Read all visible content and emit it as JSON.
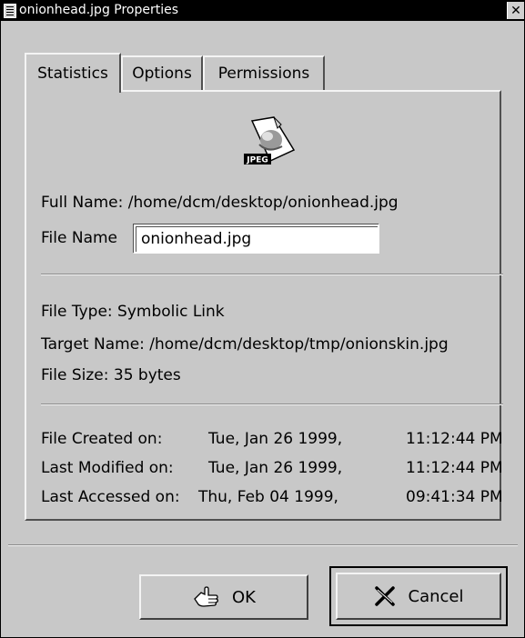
{
  "window": {
    "title": "onionhead.jpg Properties",
    "close_glyph": "✕"
  },
  "tabs": [
    {
      "label": "Statistics",
      "active": true
    },
    {
      "label": "Options",
      "active": false
    },
    {
      "label": "Permissions",
      "active": false
    }
  ],
  "file_icon": {
    "icon": "jpeg-file-icon",
    "badge_text": "JPEG"
  },
  "statistics": {
    "full_name": "Full Name: /home/dcm/desktop/onionhead.jpg",
    "file_name_label": "File Name",
    "file_name_value": "onionhead.jpg",
    "file_type": "File Type: Symbolic Link",
    "target_name": "Target Name: /home/dcm/desktop/tmp/onionskin.jpg",
    "file_size": "File Size: 35 bytes",
    "dates": [
      {
        "label": "File Created on:",
        "day": "Tue, Jan 26 1999,",
        "time": "11:12:44 PM"
      },
      {
        "label": "Last Modified on:",
        "day": "Tue, Jan 26 1999,",
        "time": "11:12:44 PM"
      },
      {
        "label": "Last Accessed on:",
        "day": "Thu, Feb 04 1999,",
        "time": "09:41:34 PM"
      }
    ]
  },
  "buttons": {
    "ok_label": "OK",
    "cancel_label": "Cancel"
  },
  "colors": {
    "window_bg": "#c8c8c8",
    "titlebar_bg": "#000000"
  }
}
